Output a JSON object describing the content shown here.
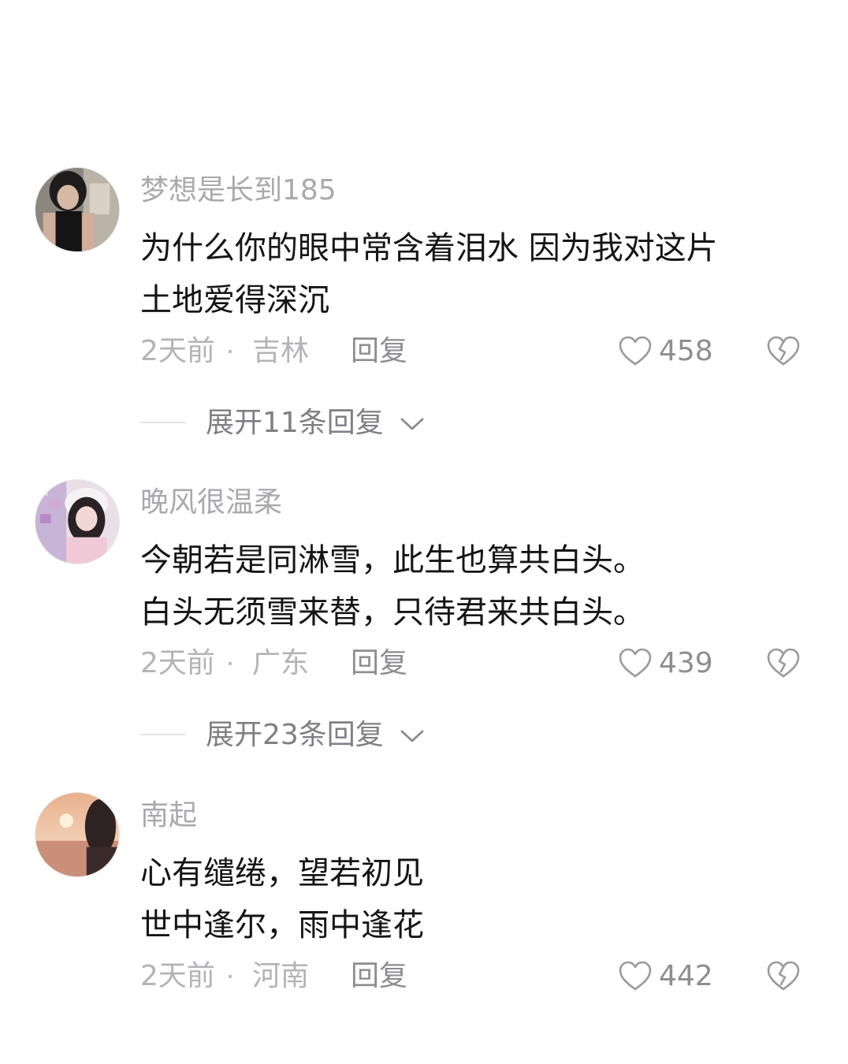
{
  "comments": [
    {
      "username": "梦想是长到185",
      "lines": [
        "为什么你的眼中常含着泪水 因为我对这片",
        "土地爱得深沉"
      ],
      "time": "2天前",
      "separator": "·",
      "location": "吉林",
      "reply_label": "回复",
      "like_count": "458",
      "expand_label": "展开11条回复"
    },
    {
      "username": "晚风很温柔",
      "lines": [
        "今朝若是同淋雪，此生也算共白头。",
        "白头无须雪来替，只待君来共白头。"
      ],
      "time": "2天前",
      "separator": "·",
      "location": "广东",
      "reply_label": "回复",
      "like_count": "439",
      "expand_label": "展开23条回复"
    },
    {
      "username": "南起",
      "lines": [
        "心有缱绻，望若初见",
        "世中逢尔，雨中逢花"
      ],
      "time": "2天前",
      "separator": "·",
      "location": "河南",
      "reply_label": "回复",
      "like_count": "442"
    }
  ],
  "icons": {
    "like": "heart-outline-icon",
    "dislike": "broken-heart-icon",
    "expand": "chevron-down-icon"
  },
  "colors": {
    "username": "#a9a9ae",
    "content": "#151515",
    "meta": "#b3b3b8",
    "action": "#8d8d92"
  }
}
